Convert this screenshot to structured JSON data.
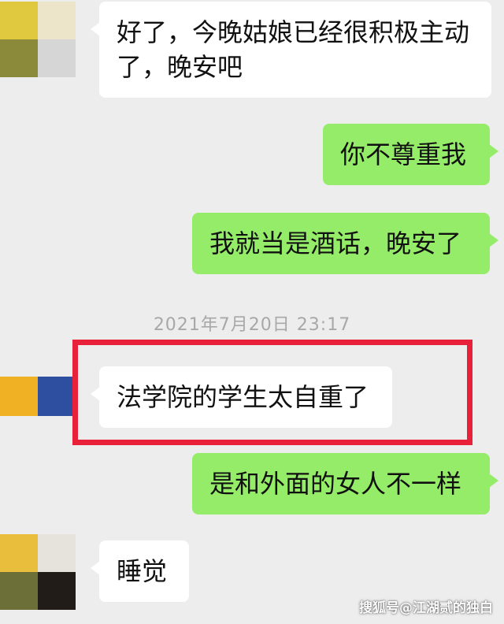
{
  "colors": {
    "background": "#ededed",
    "incoming_bubble": "#ffffff",
    "outgoing_bubble": "#95ec69",
    "highlight_border": "#e8203a",
    "timestamp_text": "#a8a8a8"
  },
  "messages": {
    "m1": {
      "sender": "other",
      "line1": "好了，今晚姑娘已经很积极主动",
      "line2": "了，晚安吧"
    },
    "m2": {
      "sender": "me",
      "text": "你不尊重我"
    },
    "m3": {
      "sender": "me",
      "text": "我就当是酒话，晚安了"
    },
    "timestamp": "2021年7月20日 23:17",
    "m4": {
      "sender": "other",
      "text": "法学院的学生太自重了"
    },
    "m5": {
      "sender": "me",
      "text": "是和外面的女人不一样"
    },
    "m6": {
      "sender": "other",
      "text": "睡觉"
    }
  },
  "watermark": "搜狐号@江湖贰的独白"
}
